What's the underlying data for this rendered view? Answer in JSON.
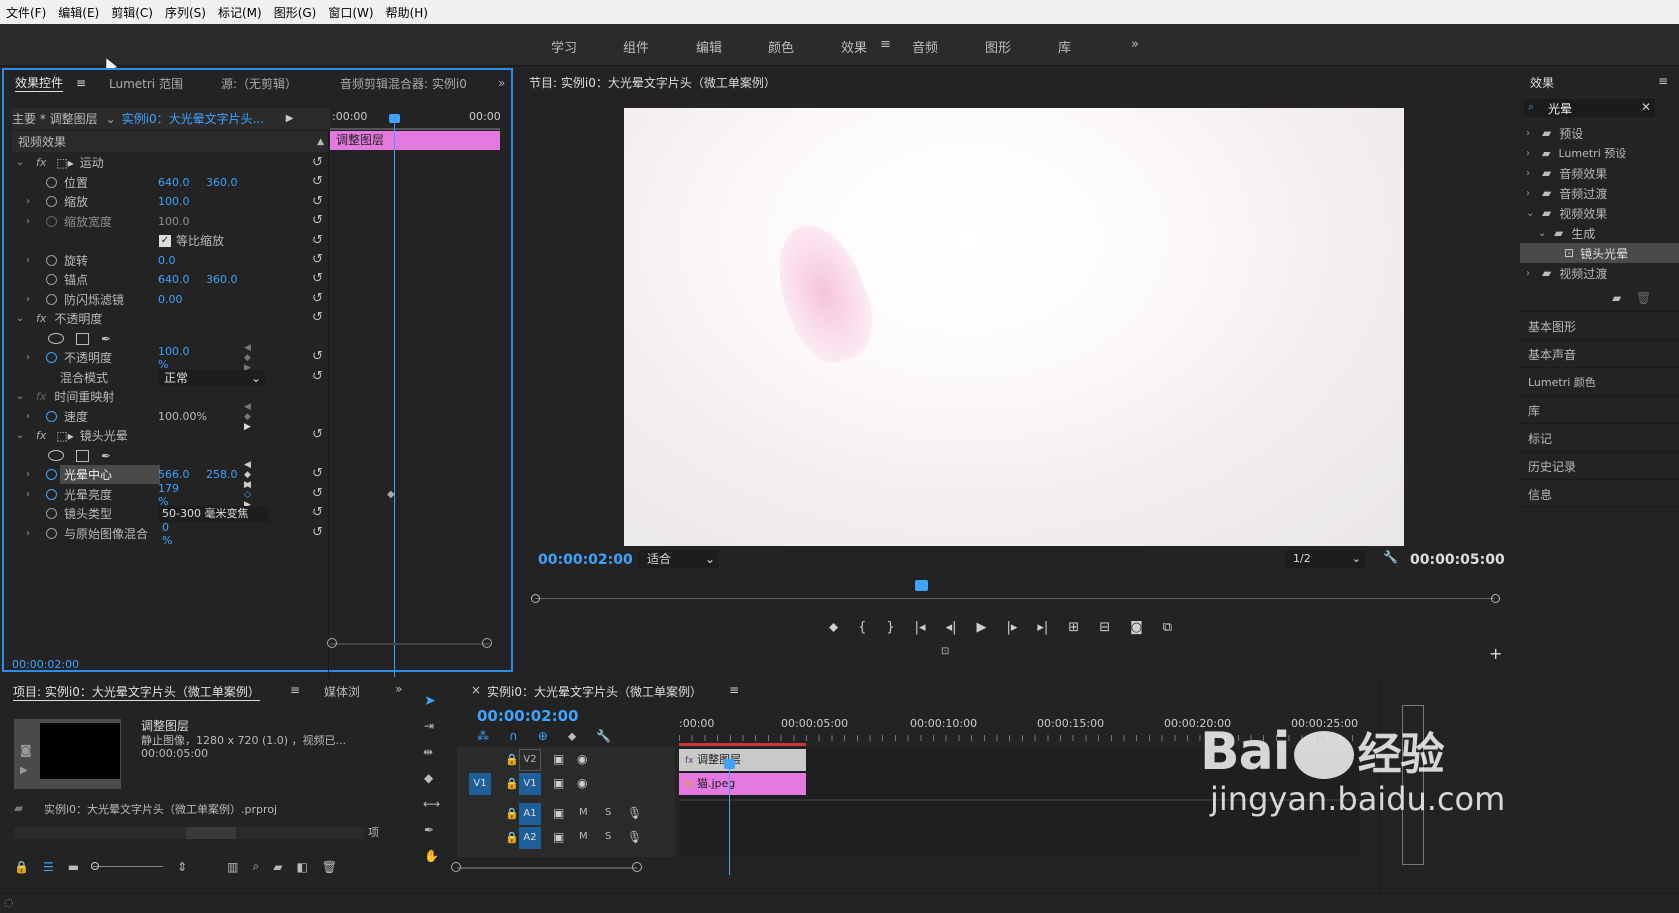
{
  "menu": [
    "文件(F)",
    "编辑(E)",
    "剪辑(C)",
    "序列(S)",
    "标记(M)",
    "图形(G)",
    "窗口(W)",
    "帮助(H)"
  ],
  "workspaces": [
    "学习",
    "组件",
    "编辑",
    "颜色",
    "效果",
    "音频",
    "图形",
    "库"
  ],
  "active_workspace": "效果",
  "effect_controls": {
    "tabs": [
      "效果控件",
      "Lumetri 范围",
      "源:（无剪辑）",
      "音频剪辑混合器: 实例i0"
    ],
    "master_label": "主要 * 调整图层",
    "sequence_label": "实例i0：大光晕文字片头...",
    "tl_start": ":00:00",
    "tl_end": "00:00",
    "clip_label": "调整图层",
    "section_video": "视频效果",
    "motion": "运动",
    "position": "位置",
    "position_x": "640.0",
    "position_y": "360.0",
    "scale": "缩放",
    "scale_v": "100.0",
    "scale_width": "缩放宽度",
    "scale_width_v": "100.0",
    "uniform": "等比缩放",
    "rotation": "旋转",
    "rotation_v": "0.0",
    "anchor": "锚点",
    "anchor_x": "640.0",
    "anchor_y": "360.0",
    "antiflicker": "防闪烁滤镜",
    "antiflicker_v": "0.00",
    "opacity_group": "不透明度",
    "opacity": "不透明度",
    "opacity_v": "100.0 %",
    "blend": "混合模式",
    "blend_v": "正常",
    "timeremap": "时间重映射",
    "speed": "速度",
    "speed_v": "100.00%",
    "lensflare": "镜头光晕",
    "flare_center": "光晕中心",
    "flare_center_x": "566.0",
    "flare_center_y": "258.0",
    "flare_bright": "光晕亮度",
    "flare_bright_v": "179 %",
    "lens_type": "镜头类型",
    "lens_type_v": "50-300 毫米变焦",
    "blend_orig": "与原始图像混合",
    "blend_orig_v": "0 %",
    "timecode": "00:00:02:00"
  },
  "program": {
    "title": "节目: 实例i0：大光晕文字片头（微工单案例）",
    "timecode": "00:00:02:00",
    "fit": "适合",
    "quality": "1/2",
    "duration": "00:00:05:00"
  },
  "effects_panel": {
    "title": "效果",
    "search": "光晕",
    "tree": [
      "预设",
      "Lumetri 预设",
      "音频效果",
      "音频过渡",
      "视频效果",
      "生成",
      "镜头光晕",
      "视频过渡"
    ],
    "extra": [
      "基本图形",
      "基本声音",
      "Lumetri 颜色",
      "库",
      "标记",
      "历史记录",
      "信息"
    ]
  },
  "project": {
    "tab1": "项目: 实例i0：大光晕文字片头（微工单案例）",
    "tab2": "媒体浏",
    "item_name": "调整图层",
    "item_info": "静止图像，1280 x 720 (1.0)  ，视频已...",
    "item_dur": "00:00:05:00",
    "file": "实例i0：大光晕文字片头（微工单案例）.prproj",
    "count": "项"
  },
  "timeline": {
    "title": "实例i0：大光晕文字片头（微工单案例）",
    "timecode": "00:00:02:00",
    "ruler": [
      ":00:00",
      "00:00:05:00",
      "00:00:10:00",
      "00:00:15:00",
      "00:00:20:00",
      "00:00:25:00"
    ],
    "tracks": [
      "V2",
      "V1",
      "A1",
      "A2"
    ],
    "src": "V1",
    "clip1": "调整图层",
    "clip2": "猫.jpeg",
    "m": "M",
    "s": "S"
  },
  "watermark": {
    "brand": "Bai",
    "cn": "经验",
    "url": "jingyan.baidu.com"
  }
}
